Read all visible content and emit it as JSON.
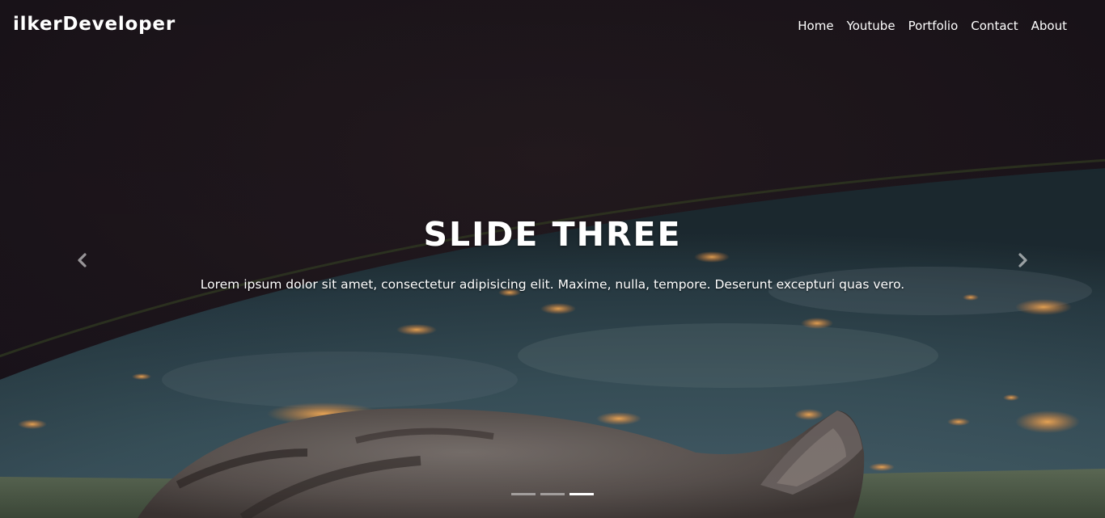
{
  "navbar": {
    "brand": "ilkerDeveloper",
    "links": [
      {
        "label": "Home"
      },
      {
        "label": "Youtube"
      },
      {
        "label": "Portfolio"
      },
      {
        "label": "Contact"
      },
      {
        "label": "About"
      }
    ]
  },
  "carousel": {
    "caption_title": "SLIDE THREE",
    "caption_text": "Lorem ipsum dolor sit amet, consectetur adipisicing elit. Maxime, nulla, tempore. Deserunt excepturi quas vero.",
    "prev_icon": "chevron-left-icon",
    "next_icon": "chevron-right-icon",
    "slide_count": 3,
    "active_index": 2
  },
  "colors": {
    "text": "#ffffff",
    "background": "#1f171b",
    "earth": "#3d5560",
    "city_lights": "#f0883a"
  }
}
